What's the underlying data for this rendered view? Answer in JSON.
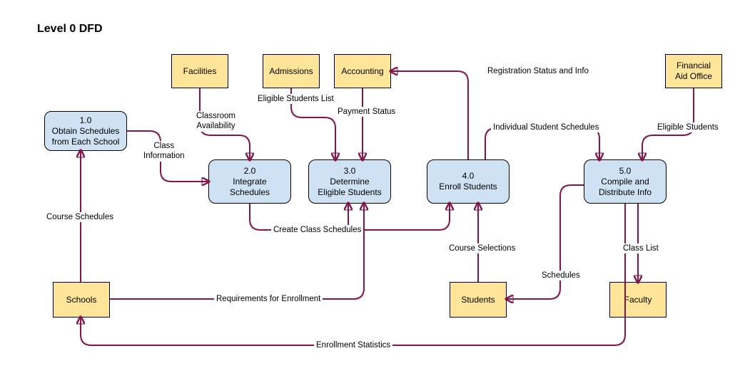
{
  "title": "Level 0 DFD",
  "entities": {
    "facilities": "Facilities",
    "admissions": "Admissions",
    "accounting": "Accounting",
    "financial_aid": "Financial\nAid Office",
    "schools": "Schools",
    "students": "Students",
    "faculty": "Faculty"
  },
  "processes": {
    "p1": {
      "num": "1.0",
      "name": "Obtain Schedules\nfrom Each School"
    },
    "p2": {
      "num": "2.0",
      "name": "Integrate\nSchedules"
    },
    "p3": {
      "num": "3.0",
      "name": "Determine\nEligible Students"
    },
    "p4": {
      "num": "4.0",
      "name": "Enroll Students"
    },
    "p5": {
      "num": "5.0",
      "name": "Compile and\nDistribute Info"
    }
  },
  "flows": {
    "course_schedules": "Course Schedules",
    "class_information": "Class\nInformation",
    "classroom_availability": "Classroom\nAvailability",
    "eligible_students_list": "Eligible Students List",
    "payment_status": "Payment Status",
    "registration_status": "Registration Status and Info",
    "eligible_students": "Eligible Students",
    "individual_schedules": "Individual Student Schedules",
    "create_class_schedules": "Create Class Schedules",
    "requirements_enrollment": "Requirements for Enrollment",
    "course_selections": "Course Selections",
    "schedules": "Schedules",
    "class_list": "Class List",
    "enrollment_statistics": "Enrollment Statistics"
  },
  "chart_data": {
    "type": "diagram",
    "title": "Level 0 DFD",
    "external_entities": [
      "Facilities",
      "Admissions",
      "Accounting",
      "Financial Aid Office",
      "Schools",
      "Students",
      "Faculty"
    ],
    "processes": [
      {
        "id": "1.0",
        "name": "Obtain Schedules from Each School"
      },
      {
        "id": "2.0",
        "name": "Integrate Schedules"
      },
      {
        "id": "3.0",
        "name": "Determine Eligible Students"
      },
      {
        "id": "4.0",
        "name": "Enroll Students"
      },
      {
        "id": "5.0",
        "name": "Compile and Distribute Info"
      }
    ],
    "data_flows": [
      {
        "from": "Schools",
        "to": "1.0",
        "label": "Course Schedules"
      },
      {
        "from": "1.0",
        "to": "2.0",
        "label": "Class Information"
      },
      {
        "from": "Facilities",
        "to": "2.0",
        "label": "Classroom Availability"
      },
      {
        "from": "Admissions",
        "to": "3.0",
        "label": "Eligible Students List"
      },
      {
        "from": "Accounting",
        "to": "3.0",
        "label": "Payment Status"
      },
      {
        "from": "4.0",
        "to": "Accounting",
        "label": "Registration Status and Info"
      },
      {
        "from": "Financial Aid Office",
        "to": "5.0",
        "label": "Eligible Students"
      },
      {
        "from": "4.0",
        "to": "5.0",
        "label": "Individual Student Schedules"
      },
      {
        "from": "2.0",
        "to": "3.0",
        "label": "Create Class Schedules"
      },
      {
        "from": "2.0",
        "to": "4.0",
        "label": "Create Class Schedules"
      },
      {
        "from": "Schools",
        "to": "3.0",
        "label": "Requirements for Enrollment"
      },
      {
        "from": "Students",
        "to": "4.0",
        "label": "Course Selections"
      },
      {
        "from": "5.0",
        "to": "Students",
        "label": "Schedules"
      },
      {
        "from": "5.0",
        "to": "Faculty",
        "label": "Class List"
      },
      {
        "from": "5.0",
        "to": "Schools",
        "label": "Enrollment Statistics"
      }
    ]
  }
}
